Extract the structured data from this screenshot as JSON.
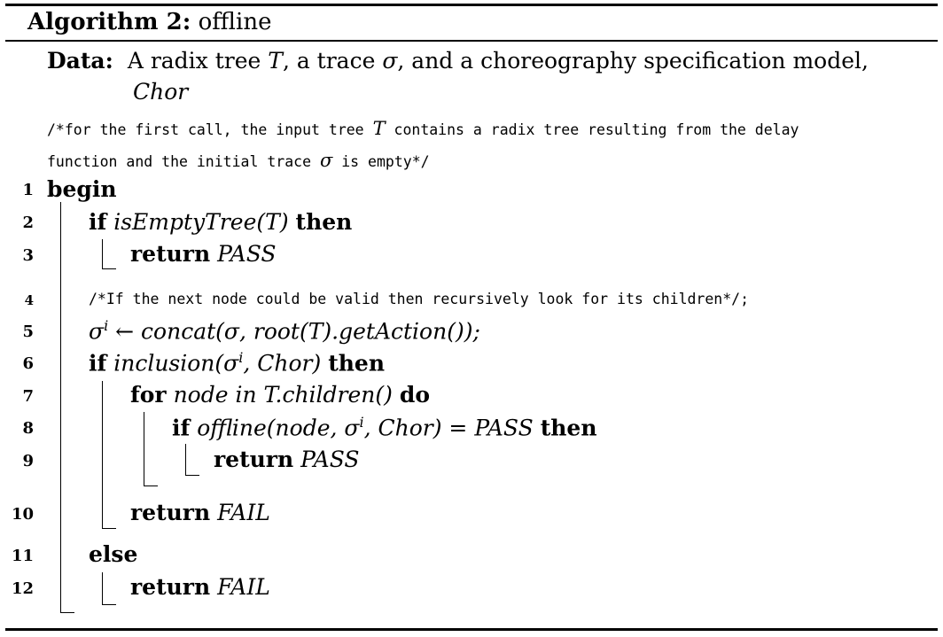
{
  "algorithm": {
    "label": "Algorithm 2:",
    "name": "offline"
  },
  "data_line": {
    "label": "Data:",
    "text_1": "A radix tree ",
    "T": "T",
    "text_2": ", a trace ",
    "sigma": "σ",
    "text_3": ", and a choreography specification model,",
    "chor": "Chor"
  },
  "comment_intro": {
    "line1_a": "/*for the first call, the input tree ",
    "line1_T": "T",
    "line1_b": " contains a radix tree resulting from the delay",
    "line2_a": "function and the initial trace ",
    "line2_sigma": "σ",
    "line2_b": " is empty*/"
  },
  "line_numbers": [
    "1",
    "2",
    "3",
    "4",
    "5",
    "6",
    "7",
    "8",
    "9",
    "10",
    "11",
    "12"
  ],
  "lines": {
    "l1": {
      "kw": "begin"
    },
    "l2": {
      "kw1": "if",
      "expr": "isEmptyTree(T)",
      "kw2": "then"
    },
    "l3": {
      "kw": "return",
      "val": "PASS"
    },
    "l4": {
      "comment": "/*If the next node could be valid then recursively look for its children*/;"
    },
    "l5": {
      "sigma": "σ",
      "sup": "i",
      "arrow": " ← ",
      "expr": "concat(σ, root(T).getAction());"
    },
    "l6": {
      "kw1": "if",
      "expr_a": "inclusion(σ",
      "sup": "i",
      "expr_b": ", Chor)",
      "kw2": "then"
    },
    "l7": {
      "kw1": "for",
      "expr": "node in T.children()",
      "kw2": "do"
    },
    "l8": {
      "kw1": "if",
      "expr_a": "offline(node, σ",
      "sup": "i",
      "expr_b": ", Chor) = PASS",
      "kw2": "then"
    },
    "l9": {
      "kw": "return",
      "val": "PASS"
    },
    "l10": {
      "kw": "return",
      "val": "FAIL"
    },
    "l11": {
      "kw": "else"
    },
    "l12": {
      "kw": "return",
      "val": "FAIL"
    }
  }
}
